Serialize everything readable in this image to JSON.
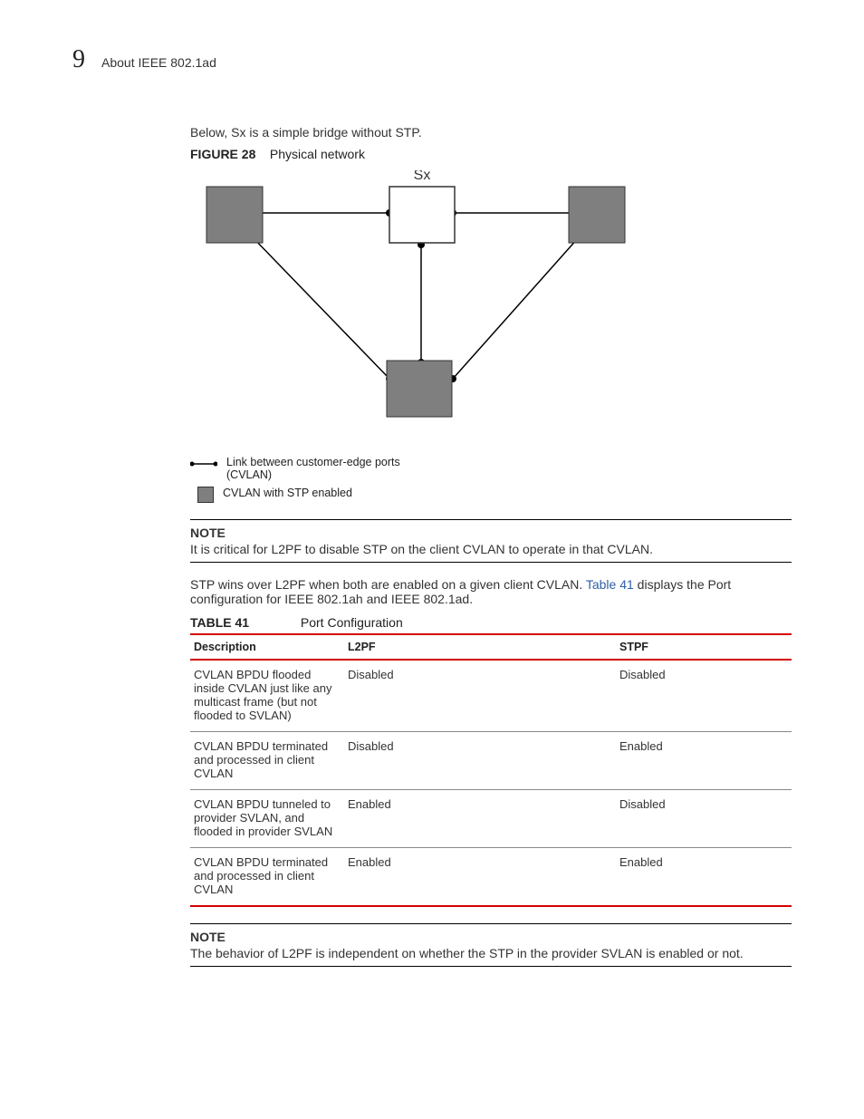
{
  "header": {
    "chapter_number": "9",
    "title": "About IEEE 802.1ad"
  },
  "intro_para": "Below, Sx is a simple bridge without STP.",
  "figure": {
    "label": "FIGURE 28",
    "caption": "Physical network",
    "top_label": "Sx"
  },
  "legend": {
    "line": "Link between customer-edge ports (CVLAN)",
    "square": "CVLAN with STP enabled"
  },
  "note1": {
    "label": "NOTE",
    "text": "It is critical for L2PF to disable STP on the client CVLAN to operate in that CVLAN."
  },
  "para2_pre": "STP wins over L2PF when both are enabled on a given client CVLAN. ",
  "para2_link": "Table 41",
  "para2_post": " displays the Port configuration for IEEE 802.1ah and IEEE 802.1ad.",
  "table": {
    "label": "TABLE 41",
    "caption": "Port Configuration",
    "headers": {
      "c1": "Description",
      "c2": "L2PF",
      "c3": "STPF"
    },
    "rows": [
      {
        "desc": "CVLAN BPDU flooded inside CVLAN just like any multicast frame (but not flooded to SVLAN)",
        "l2pf": "Disabled",
        "stpf": "Disabled"
      },
      {
        "desc": "CVLAN BPDU terminated and processed in client CVLAN",
        "l2pf": "Disabled",
        "stpf": "Enabled"
      },
      {
        "desc": "CVLAN BPDU tunneled to provider SVLAN, and flooded in provider SVLAN",
        "l2pf": "Enabled",
        "stpf": "Disabled"
      },
      {
        "desc": "CVLAN BPDU terminated and processed in client CVLAN",
        "l2pf": "Enabled",
        "stpf": "Enabled"
      }
    ]
  },
  "note2": {
    "label": "NOTE",
    "text": "The behavior of L2PF is independent on whether the STP in the provider SVLAN is enabled or not."
  }
}
